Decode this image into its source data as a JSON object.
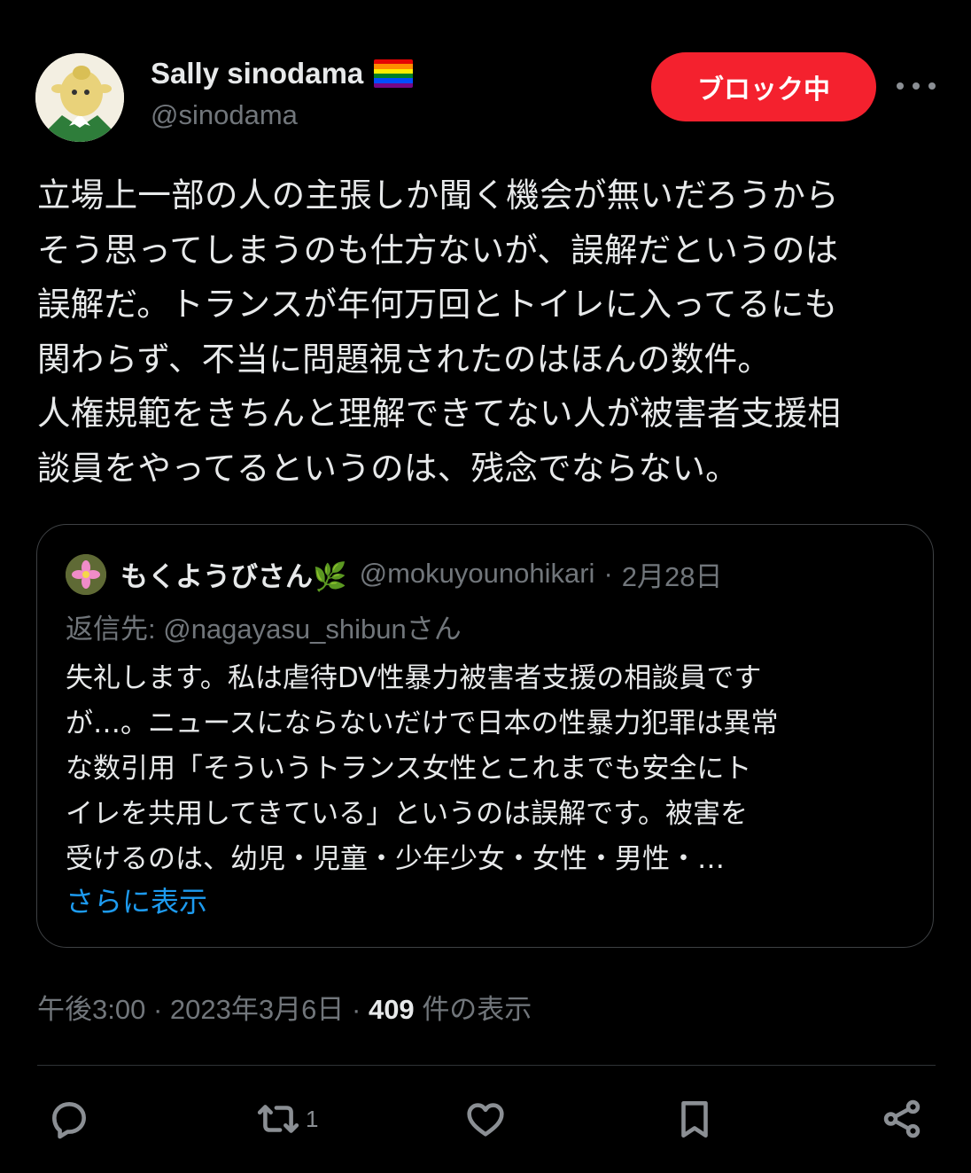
{
  "author": {
    "display_name": "Sally sinodama",
    "handle": "@sinodama",
    "flag_colors": [
      "#e40303",
      "#ff8c00",
      "#ffed00",
      "#008026",
      "#004dff",
      "#750787"
    ]
  },
  "block_button": {
    "label": "ブロック中",
    "color": "#f4212e"
  },
  "more_menu": {
    "icon": "more-horizontal-icon"
  },
  "tweet": {
    "text": "立場上一部の人の主張しか聞く機会が無いだろうから\nそう思ってしまうのも仕方ないが、誤解だというのは\n誤解だ。トランスが年何万回とトイレに入ってるにも\n関わらず、不当に問題視されたのはほんの数件。\n人権規範をきちんと理解できてない人が被害者支援相\n談員をやってるというのは、残念でならない。"
  },
  "quoted_tweet": {
    "display_name": "もくようびさん🌿",
    "handle": "@mokuyounohikari",
    "separator": "·",
    "date": "2月28日",
    "reply_to": "返信先: @nagayasu_shibunさん",
    "text": "失礼します。私は虐待DV性暴力被害者支援の相談員です\nが…。ニュースにならないだけで日本の性暴力犯罪は異常\nな数引用「そういうトランス女性とこれまでも安全にト\nイレを共用してきている」というのは誤解です。被害を\n受けるのは、幼児・児童・少年少女・女性・男性・…",
    "show_more": "さらに表示",
    "link_color": "#1d9bf0"
  },
  "meta": {
    "time": "午後3:00",
    "separator": "·",
    "date": "2023年3月6日",
    "views_count": "409",
    "views_label": "件の表示"
  },
  "actions": {
    "reply_icon": "reply-icon",
    "retweet_icon": "retweet-icon",
    "retweet_count": "1",
    "like_icon": "heart-icon",
    "bookmark_icon": "bookmark-icon",
    "share_icon": "share-icon"
  }
}
